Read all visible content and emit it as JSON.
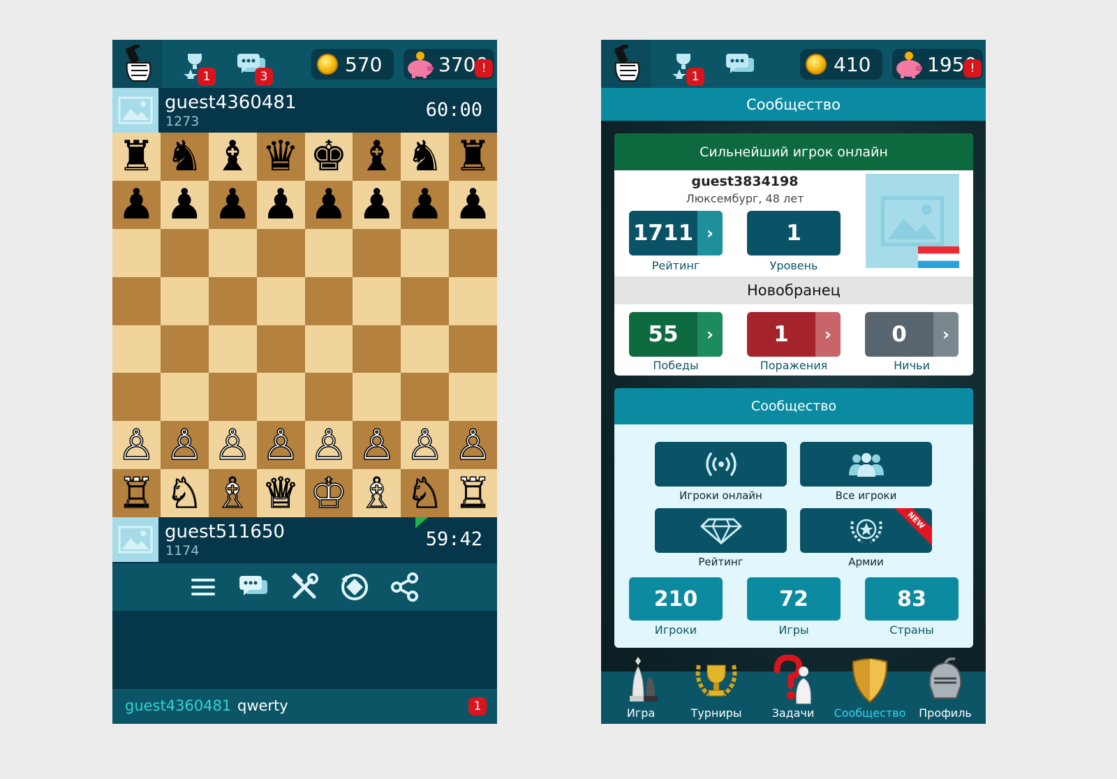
{
  "left": {
    "topbar": {
      "trophy_badge": "1",
      "chat_badge": "3",
      "coins": "570",
      "savings": "3700",
      "savings_alert": "!"
    },
    "opponent": {
      "name": "guest4360481",
      "rating": "1273",
      "time": "60:00"
    },
    "player": {
      "name": "guest511650",
      "rating": "1174",
      "time": "59:42"
    },
    "board": {
      "rows": [
        [
          "♜",
          "♞",
          "♝",
          "♛",
          "♚",
          "♝",
          "♞",
          "♜"
        ],
        [
          "♟",
          "♟",
          "♟",
          "♟",
          "♟",
          "♟",
          "♟",
          "♟"
        ],
        [
          "",
          "",
          "",
          "",
          "",
          "",
          "",
          ""
        ],
        [
          "",
          "",
          "",
          "",
          "",
          "",
          "",
          ""
        ],
        [
          "",
          "",
          "",
          "",
          "",
          "",
          "",
          ""
        ],
        [
          "",
          "",
          "",
          "",
          "",
          "",
          "",
          ""
        ],
        [
          "♙",
          "♙",
          "♙",
          "♙",
          "♙",
          "♙",
          "♙",
          "♙"
        ],
        [
          "♖",
          "♘",
          "♗",
          "♕",
          "♔",
          "♗",
          "♘",
          "♖"
        ]
      ]
    },
    "actions": [
      "menu-icon",
      "chat-icon",
      "tools-icon",
      "resign-icon",
      "share-icon"
    ],
    "chat": {
      "user": "guest4360481",
      "message": "qwerty",
      "badge": "1"
    }
  },
  "right": {
    "topbar": {
      "trophy_badge": "1",
      "coins": "410",
      "savings": "1950",
      "savings_alert": "!"
    },
    "title": "Сообщество",
    "strongest": {
      "header": "Сильнейший игрок онлайн",
      "name": "guest3834198",
      "location": "Люксембург, 48 лет",
      "rating": "1711",
      "rating_label": "Рейтинг",
      "level": "1",
      "level_label": "Уровень",
      "rank": "Новобранец",
      "wins": "55",
      "wins_label": "Победы",
      "losses": "1",
      "losses_label": "Поражения",
      "draws": "0",
      "draws_label": "Ничьи",
      "arrow": "›"
    },
    "community": {
      "header": "Сообщество",
      "buttons": [
        "Игроки онлайн",
        "Все игроки",
        "Рейтинг",
        "Армии"
      ],
      "new_label": "NEW",
      "players": "210",
      "players_label": "Игроки",
      "games": "72",
      "games_label": "Игры",
      "countries": "83",
      "countries_label": "Страны"
    },
    "tabs": [
      "Игра",
      "Турниры",
      "Задачи",
      "Сообщество",
      "Профиль"
    ],
    "active_tab": "Сообщество"
  },
  "colors": {
    "bar": "#0b5567",
    "accent": "#35d6ee",
    "win": "#0d6a3f",
    "loss": "#b3262c",
    "draw": "#5a6770",
    "badge": "#d8141d"
  }
}
